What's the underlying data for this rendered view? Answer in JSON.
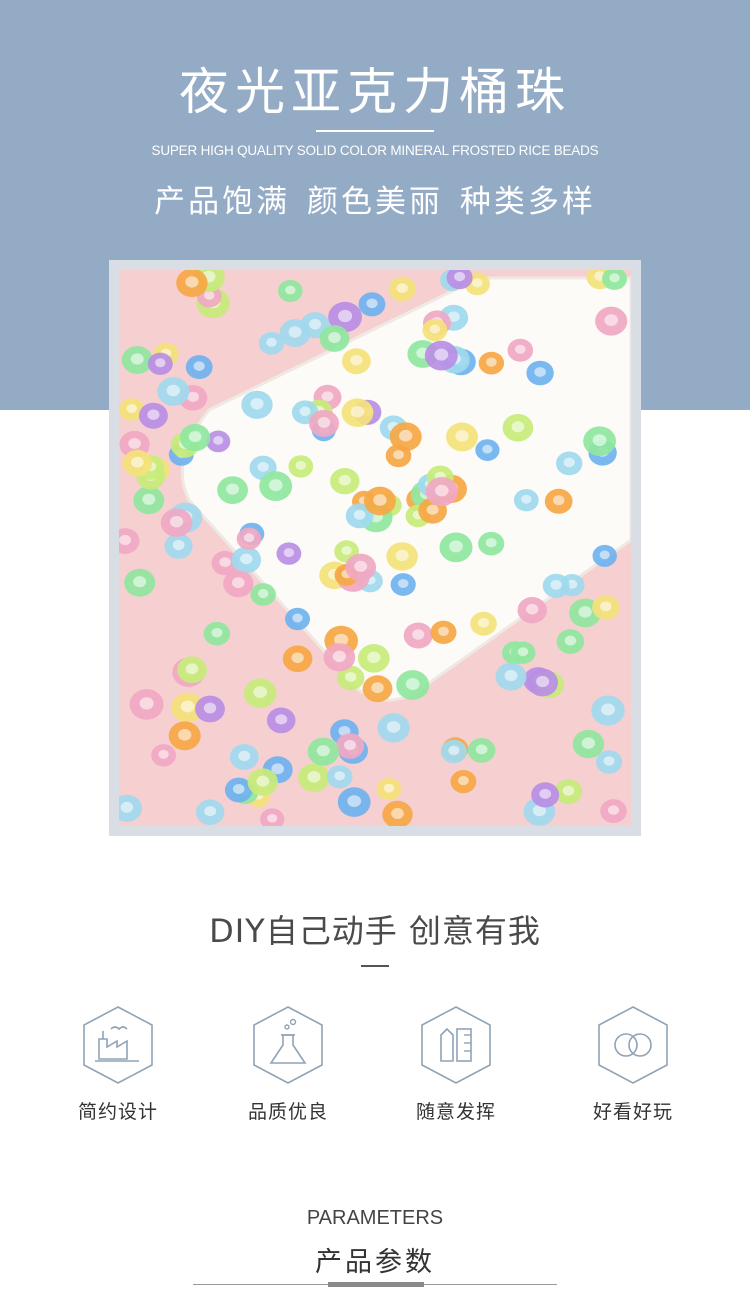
{
  "hero": {
    "title": "夜光亚克力桶珠",
    "subtitle_en": "SUPER HIGH QUALITY SOLID COLOR MINERAL FROSTED RICE BEADS",
    "slogan": "产品饱满 颜色美丽 种类多样",
    "background_color": "#94abc6"
  },
  "photo": {
    "background_color": "#f6cfd0",
    "tray_color": "#ffffff",
    "bead_colors": [
      "#f0a8c2",
      "#9fd9ee",
      "#f4e27a",
      "#6fb2ef",
      "#b88ee4",
      "#8fe79e",
      "#f6a743",
      "#c7eb7a"
    ]
  },
  "diy": {
    "title": "DIY自己动手 创意有我"
  },
  "features": [
    {
      "label": "简约设计",
      "icon": "factory-icon"
    },
    {
      "label": "品质优良",
      "icon": "flask-icon"
    },
    {
      "label": "随意发挥",
      "icon": "ruler-pencil-icon"
    },
    {
      "label": "好看好玩",
      "icon": "rings-icon"
    }
  ],
  "parameters": {
    "title_en": "PARAMETERS",
    "title_cn": "产品参数"
  }
}
